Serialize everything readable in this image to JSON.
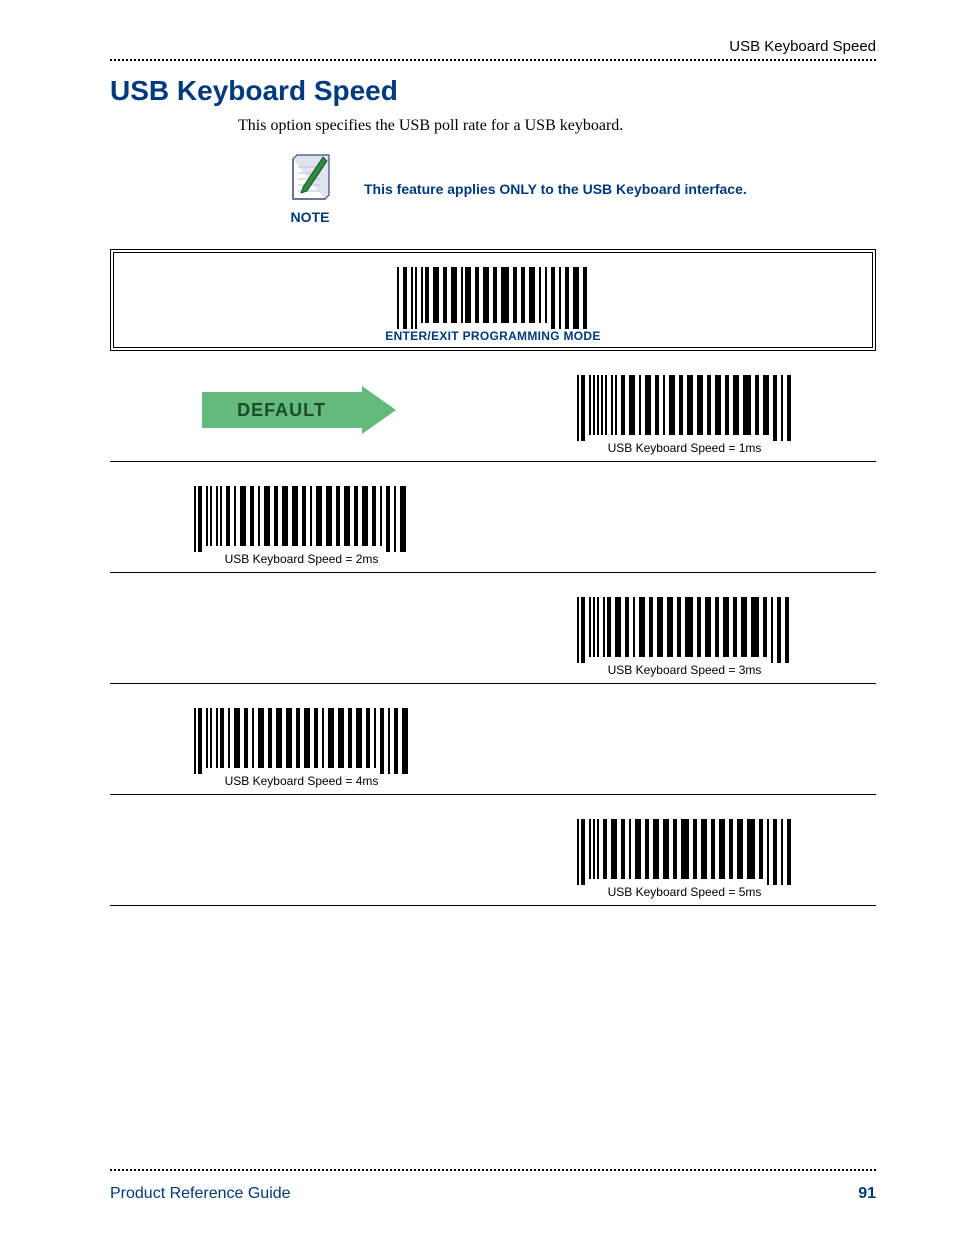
{
  "header": {
    "topright": "USB Keyboard Speed"
  },
  "title": "USB Keyboard Speed",
  "lead": "This option specifies the USB poll rate for a USB keyboard.",
  "note": {
    "label": "NOTE",
    "text": "This feature applies ONLY to the USB Keyboard interface."
  },
  "frame": {
    "label": "ENTER/EXIT PROGRAMMING MODE"
  },
  "default_arrow": "DEFAULT",
  "options": {
    "opt1": "USB Keyboard Speed = 1ms",
    "opt2": "USB Keyboard Speed = 2ms",
    "opt3": "USB Keyboard Speed = 3ms",
    "opt4": "USB Keyboard Speed = 4ms",
    "opt5": "USB Keyboard Speed = 5ms"
  },
  "footer": {
    "guide": "Product Reference Guide",
    "page": "91"
  }
}
